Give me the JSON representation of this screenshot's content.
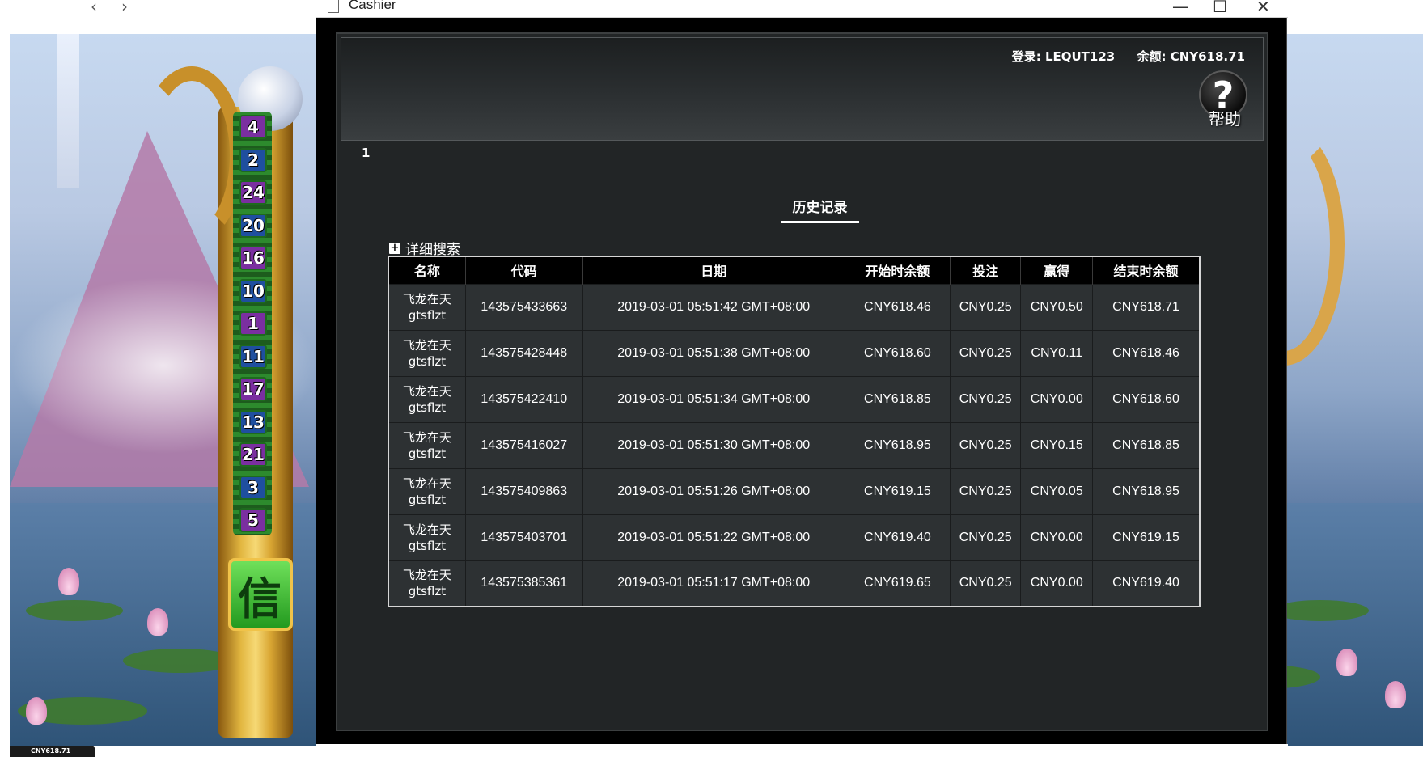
{
  "window": {
    "title": "Cashier",
    "controls": {
      "minimize": "—",
      "maximize": "☐",
      "close": "✕"
    }
  },
  "browser_nav": {
    "back": "‹",
    "forward": "›"
  },
  "account": {
    "login_label": "登录: LEQUT123",
    "balance_label": "余额: CNY618.71"
  },
  "help": {
    "symbol": "?",
    "label": "帮助"
  },
  "page_number": "1",
  "section_title": "历史记录",
  "advanced_search": {
    "icon": "+",
    "label": "详细搜索"
  },
  "table": {
    "headers": [
      "名称",
      "代码",
      "日期",
      "开始时余额",
      "投注",
      "赢得",
      "结束时余额"
    ],
    "rows": [
      {
        "name": "飞龙在天",
        "game_code": "gtsflzt",
        "code": "143575433663",
        "date": "2019-03-01 05:51:42 GMT+08:00",
        "start_balance": "CNY618.46",
        "bet": "CNY0.25",
        "win": "CNY0.50",
        "end_balance": "CNY618.71"
      },
      {
        "name": "飞龙在天",
        "game_code": "gtsflzt",
        "code": "143575428448",
        "date": "2019-03-01 05:51:38 GMT+08:00",
        "start_balance": "CNY618.60",
        "bet": "CNY0.25",
        "win": "CNY0.11",
        "end_balance": "CNY618.46"
      },
      {
        "name": "飞龙在天",
        "game_code": "gtsflzt",
        "code": "143575422410",
        "date": "2019-03-01 05:51:34 GMT+08:00",
        "start_balance": "CNY618.85",
        "bet": "CNY0.25",
        "win": "CNY0.00",
        "end_balance": "CNY618.60"
      },
      {
        "name": "飞龙在天",
        "game_code": "gtsflzt",
        "code": "143575416027",
        "date": "2019-03-01 05:51:30 GMT+08:00",
        "start_balance": "CNY618.95",
        "bet": "CNY0.25",
        "win": "CNY0.15",
        "end_balance": "CNY618.85"
      },
      {
        "name": "飞龙在天",
        "game_code": "gtsflzt",
        "code": "143575409863",
        "date": "2019-03-01 05:51:26 GMT+08:00",
        "start_balance": "CNY619.15",
        "bet": "CNY0.25",
        "win": "CNY0.05",
        "end_balance": "CNY618.95"
      },
      {
        "name": "飞龙在天",
        "game_code": "gtsflzt",
        "code": "143575403701",
        "date": "2019-03-01 05:51:22 GMT+08:00",
        "start_balance": "CNY619.40",
        "bet": "CNY0.25",
        "win": "CNY0.00",
        "end_balance": "CNY619.15"
      },
      {
        "name": "飞龙在天",
        "game_code": "gtsflzt",
        "code": "143575385361",
        "date": "2019-03-01 05:51:17 GMT+08:00",
        "start_balance": "CNY619.65",
        "bet": "CNY0.25",
        "win": "CNY0.00",
        "end_balance": "CNY619.40"
      }
    ]
  },
  "game": {
    "paylines": [
      "4",
      "2",
      "24",
      "20",
      "16",
      "10",
      "1",
      "11",
      "17",
      "13",
      "21",
      "3",
      "5"
    ],
    "spin_button_text": "信",
    "balance_chip": "CNY618.71"
  },
  "colors": {
    "panel_bg": "#222526",
    "table_header_bg": "#000000",
    "table_row_bg": "#2d3133",
    "text": "#ffffff"
  }
}
